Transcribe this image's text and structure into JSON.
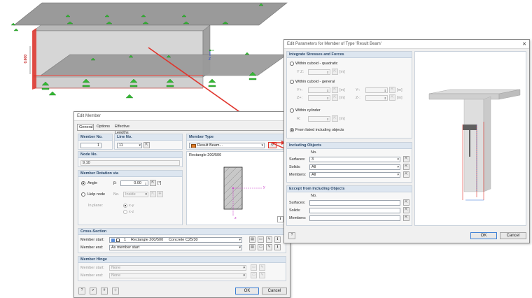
{
  "model": {
    "dimension_label": "0.600",
    "axis_z": "Z",
    "axis_x": "X",
    "axis_y": "Y"
  },
  "edit_member": {
    "title": "Edit Member",
    "tabs": [
      "General",
      "Options",
      "Effective Lengths"
    ],
    "member_no_label": "Member No.",
    "member_no": "1",
    "line_no_label": "Line No.",
    "line_no": "11",
    "member_type_label": "Member Type",
    "member_type": "Result Beam...",
    "node_no_label": "Node No.",
    "node_no": "9,10",
    "rotation_label": "Member Rotation via",
    "angle_label": "Angle",
    "beta_label": "β:",
    "angle_value": "0.00",
    "angle_unit": "[°]",
    "help_node_label": "Help node",
    "no_label": "No.",
    "help_node_value": "Inside",
    "in_plane_label": "In plane:",
    "plane_xy": "x-y",
    "plane_xz": "x-z",
    "preview_label": "Rectangle 200/500",
    "preview_axis_y": "y",
    "preview_axis_z": "z",
    "cross_section_label": "Cross-Section",
    "member_start_label": "Member start:",
    "member_start_no": "1",
    "member_start_name": "Rectangle 200/500",
    "member_start_material": "Concrete C25/30",
    "member_end_label": "Member end:",
    "member_end_value": "As member start",
    "hinge_label": "Member Hinge",
    "hinge_start_label": "Member start:",
    "hinge_start_value": "None",
    "hinge_end_label": "Member end:",
    "hinge_end_value": "None",
    "ok": "OK",
    "cancel": "Cancel"
  },
  "edit_params": {
    "title": "Edit Parameters for Member of Type 'Result Beam'",
    "close": "✕",
    "integrate_label": "Integrate Stresses and Forces",
    "cuboid_quadratic": "Within cuboid - quadratic",
    "yz_label": "Y Z:",
    "unit_m": "[m]",
    "cuboid_general": "Within cuboid - general",
    "y_plus": "Y+:",
    "y_minus": "Y-:",
    "z_plus": "Z+:",
    "z_minus": "Z-:",
    "cylinder": "Within cylinder",
    "r_label": "R:",
    "from_listed": "From listed including objects",
    "including_label": "Including Objects",
    "no_col": "No.",
    "surfaces_label": "Surfaces:",
    "surfaces_value": "3",
    "solids_label": "Solids:",
    "solids_value": "All",
    "members_label": "Members:",
    "members_value": "All",
    "except_label": "Except from Including Objects",
    "ok": "OK",
    "cancel": "Cancel"
  },
  "colors": {
    "accent_red": "#e0342c",
    "support_green": "#33b833",
    "section_head": "#dde6f0"
  }
}
